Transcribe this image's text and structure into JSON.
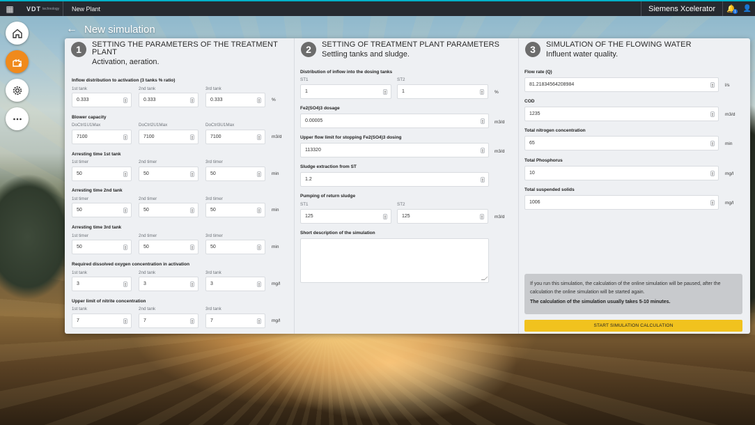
{
  "topbar": {
    "logo_text": "VDT",
    "logo_small": "technology",
    "tab_label": "New Plant",
    "brand": "Siemens Xcelerator",
    "notification_count": "1"
  },
  "page": {
    "title": "New simulation"
  },
  "colors": {
    "accent": "#f08a1c",
    "button": "#f1c21e",
    "topbar": "#262a30",
    "topbar_line": "#00b0c8"
  },
  "section1": {
    "number": "1",
    "title": "SETTING THE PARAMETERS OF THE TREATMENT PLANT",
    "subtitle": "Activation, aeration.",
    "inflow": {
      "label": "Inflow distribution to activation (3 tanks % ratio)",
      "sub": [
        "1st tank",
        "2nd tank",
        "3rd tank"
      ],
      "values": [
        "0.333",
        "0.333",
        "0.333"
      ],
      "unit": "%"
    },
    "blower": {
      "label": "Blower capacity",
      "sub": [
        "DoCtrl1U1Max",
        "DoCtrl2U1Max",
        "DoCtrl3U1Max"
      ],
      "values": [
        "7100",
        "7100",
        "7100"
      ],
      "unit": "m3/d"
    },
    "arrest1": {
      "label": "Arresting time 1st tank",
      "sub": [
        "1st timer",
        "2nd timer",
        "3rd timer"
      ],
      "values": [
        "50",
        "50",
        "50"
      ],
      "unit": "min"
    },
    "arrest2": {
      "label": "Arresting time 2nd tank",
      "sub": [
        "1st timer",
        "2nd timer",
        "3rd timer"
      ],
      "values": [
        "50",
        "50",
        "50"
      ],
      "unit": "min"
    },
    "arrest3": {
      "label": "Arresting time 3rd tank",
      "sub": [
        "1st timer",
        "2nd timer",
        "3rd timer"
      ],
      "values": [
        "50",
        "50",
        "50"
      ],
      "unit": "min"
    },
    "oxygen": {
      "label": "Required dissolved oxygen concentration in activation",
      "sub": [
        "1st tank",
        "2nd tank",
        "3rd tank"
      ],
      "values": [
        "3",
        "3",
        "3"
      ],
      "unit": "mg/l"
    },
    "nitrite": {
      "label": "Upper limit of nitrite concentration",
      "sub": [
        "1st tank",
        "2nd tank",
        "3rd tank"
      ],
      "values": [
        "7",
        "7",
        "7"
      ],
      "unit": "mg/l"
    }
  },
  "section2": {
    "number": "2",
    "title": "SETTING OF TREATMENT PLANT PARAMETERS",
    "subtitle": "Settling tanks and sludge.",
    "dosing": {
      "label": "Distribution of inflow into the dosing tanks",
      "sub": [
        "ST1",
        "ST2"
      ],
      "values": [
        "1",
        "1"
      ],
      "unit": "%"
    },
    "fe_dosage": {
      "label": "Fe2(SO4)3 dosage",
      "value": "0.00005",
      "unit": "m3/d"
    },
    "upper_flow": {
      "label": "Upper flow limit for stopping Fe2(SO4)3 dosing",
      "value": "113320",
      "unit": "m3/d"
    },
    "sludge": {
      "label": "Sludge extraction from ST",
      "value": "1.2"
    },
    "pumping": {
      "label": "Pumping of return sludge",
      "sub": [
        "ST1",
        "ST2"
      ],
      "values": [
        "125",
        "125"
      ],
      "unit": "m3/d"
    },
    "description": {
      "label": "Short description of the simulation",
      "value": ""
    }
  },
  "section3": {
    "number": "3",
    "title": "SIMULATION OF THE FLOWING WATER",
    "subtitle": "Influent water quality.",
    "flow": {
      "label": "Flow rate (Q)",
      "value": "81.21834564208984",
      "unit": "l/s"
    },
    "cod": {
      "label": "COD",
      "value": "1235",
      "unit": "m3/d"
    },
    "nitrogen": {
      "label": "Total nitrogen concentration",
      "value": "65",
      "unit": "min"
    },
    "phosphorus": {
      "label": "Total Phosphorus",
      "value": "10",
      "unit": "mg/l"
    },
    "solids": {
      "label": "Total suspended solids",
      "value": "1006",
      "unit": "mg/l"
    },
    "info_text": "If you run this simulation, the calculation of the online simulation will be paused, after the calculation the online simulation will be started again.",
    "info_bold": "The calculation of the simulation usually takes 5-10 minutes.",
    "start_button": "START SIMULATION CALCULATION"
  }
}
